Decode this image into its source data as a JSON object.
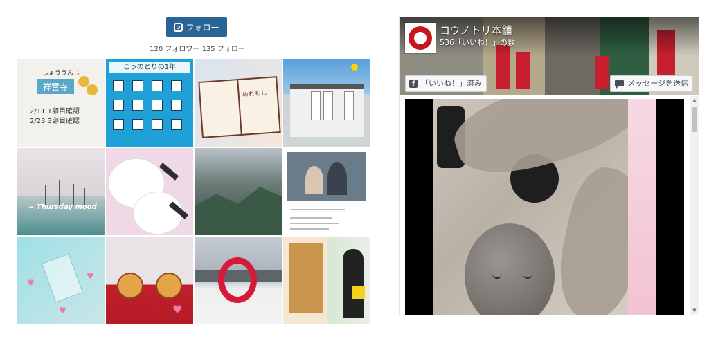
{
  "instagram": {
    "follow_label": "フォロー",
    "stats": "120 フォロワー 135 フォロー",
    "tiles": {
      "t1_sign": "祥雲寺",
      "t1_small": "しょううんじ",
      "t1_line1": "2/11  1卵目確認",
      "t1_line2": "2/23  3卵目確認",
      "t2_banner": "こうのとりの1年",
      "t3_text": "めれもし",
      "t5_caption": "~ Thursday mood"
    }
  },
  "facebook": {
    "page_name": "コウノトリ本舗",
    "likes_text": "536「いいね！」の数",
    "like_button": "「いいね！」済み",
    "message_button": "メッセージを送信",
    "icons": {
      "like": "facebook-logo-icon",
      "message": "message-icon"
    }
  },
  "colors": {
    "follow_button": "#2a6496",
    "facebook_red": "#c8161d"
  }
}
